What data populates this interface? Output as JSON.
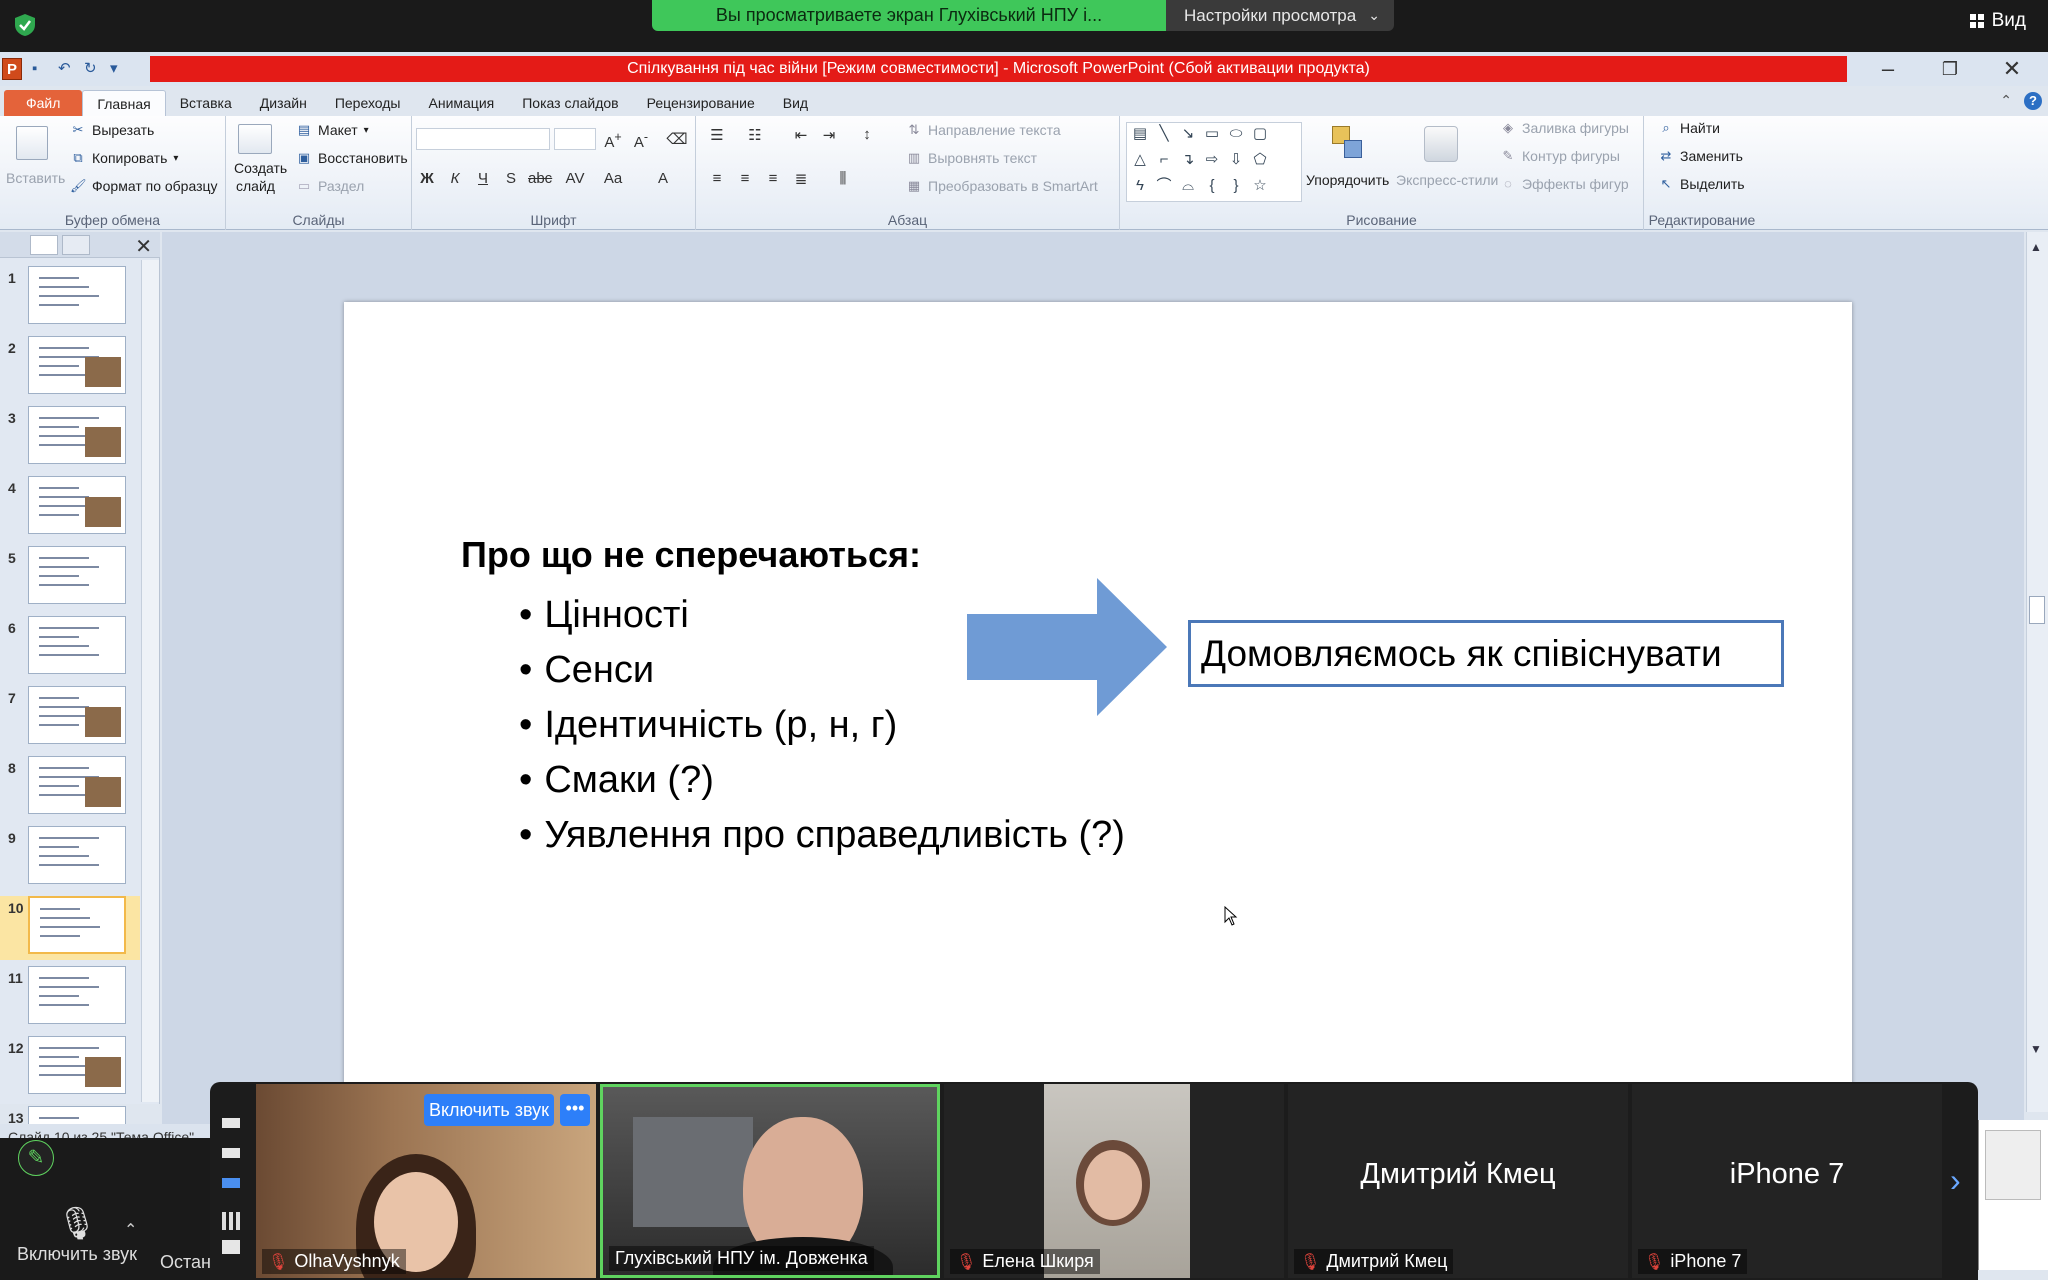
{
  "zoom": {
    "banner": "Вы просматриваете экран Глухівський НПУ і...",
    "view_settings": "Настройки просмотра",
    "view_button": "Вид",
    "unmute_label": "Включить звук",
    "stop_label": "Остан",
    "unmute_participant": "Включить звук",
    "more": "•••",
    "participants": [
      {
        "name": "OlhaVyshnyk",
        "muted": true
      },
      {
        "name": "Глухівський НПУ ім. Довженка",
        "muted": false
      },
      {
        "name": "Елена Шкиря",
        "muted": true
      },
      {
        "name": "Дмитрий Кмец",
        "muted": true,
        "center": "Дмитрий Кмец"
      },
      {
        "name": "iPhone 7",
        "muted": true,
        "center": "iPhone 7"
      }
    ],
    "accent": "#3fc75a"
  },
  "ppt": {
    "title": "Спілкування під час війни [Режим совместимости]  -  Microsoft PowerPoint (Сбой активации продукта)",
    "tabs": [
      "Файл",
      "Главная",
      "Вставка",
      "Дизайн",
      "Переходы",
      "Анимация",
      "Показ слайдов",
      "Рецензирование",
      "Вид"
    ],
    "groups": {
      "clipboard": {
        "label": "Буфер обмена",
        "paste": "Вставить",
        "cut": "Вырезать",
        "copy": "Копировать",
        "format": "Формат по образцу"
      },
      "slides": {
        "label": "Слайды",
        "create": "Создать",
        "create2": "слайд",
        "layout": "Макет",
        "reset": "Восстановить",
        "section": "Раздел"
      },
      "font": {
        "label": "Шрифт"
      },
      "paragraph": {
        "label": "Абзац",
        "direction": "Направление текста",
        "align": "Выровнять текст",
        "smartart": "Преобразовать в SmartArt"
      },
      "drawing": {
        "label": "Рисование",
        "arrange": "Упорядочить",
        "styles": "Экспресс-стили",
        "fill": "Заливка фигуры",
        "outline": "Контур фигуры",
        "effects": "Эффекты фигур"
      },
      "editing": {
        "label": "Редактирование",
        "find": "Найти",
        "replace": "Заменить",
        "select": "Выделить"
      }
    },
    "slide_numbers": [
      "1",
      "2",
      "3",
      "4",
      "5",
      "6",
      "7",
      "8",
      "9",
      "10",
      "11",
      "12",
      "13"
    ],
    "status": "Слайд 10 из 25   \"Тема Office\"",
    "brand_color": "#e41b17"
  },
  "slide": {
    "title": "Про що не сперечаються:",
    "bullets": [
      "Цінності",
      "Сенси",
      "Ідентичність (р, н, г)",
      "Смаки (?)",
      "Уявлення про справедливість (?)"
    ],
    "callout": "Домовляємось як співіснувати"
  }
}
